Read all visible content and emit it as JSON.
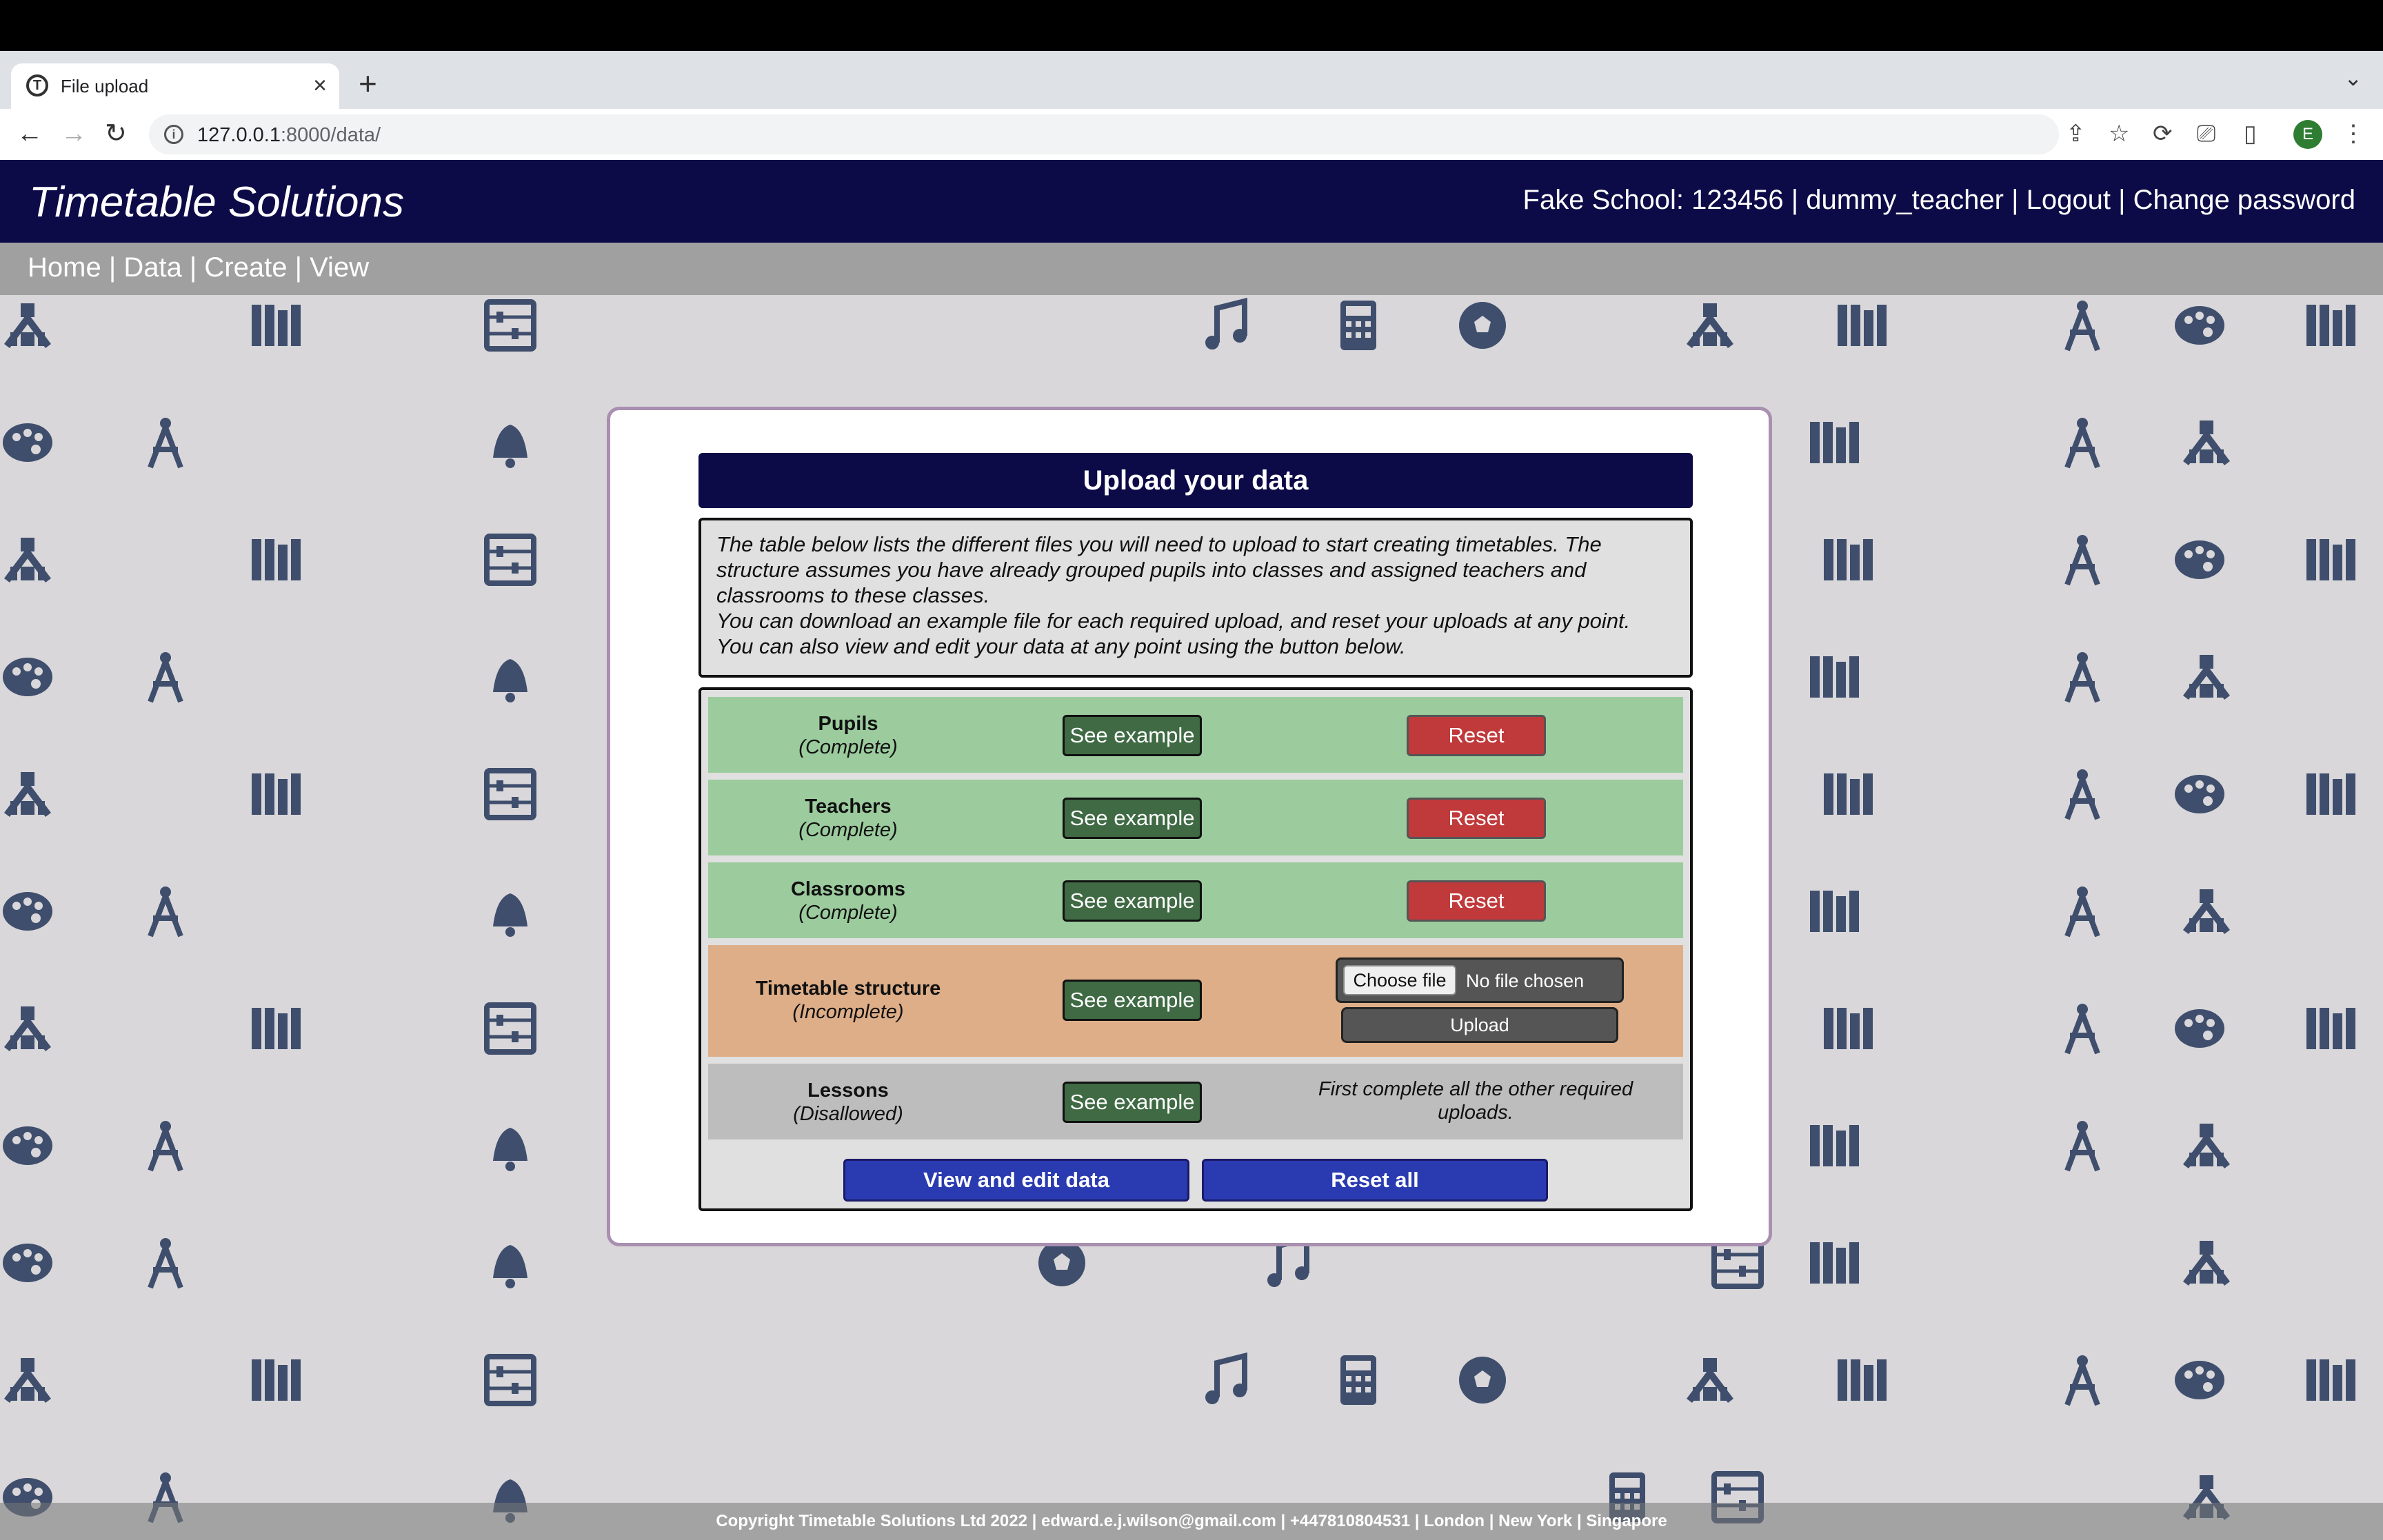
{
  "browser": {
    "tab_title": "File upload",
    "tab_close": "×",
    "new_tab": "+",
    "url_host": "127.0.0.1",
    "url_path": ":8000/data/",
    "profile_initial": "E"
  },
  "header": {
    "brand": "Timetable Solutions",
    "account": "Fake School: 123456 | dummy_teacher | Logout | Change password"
  },
  "nav": {
    "links": "Home | Data | Create | View"
  },
  "modal": {
    "title": "Upload your data",
    "intro": [
      "The table below lists the different files you will need to upload to start creating timetables. The structure assumes you have already grouped pupils into classes and assigned teachers and classrooms to these classes.",
      "You can download an example file for each required upload, and reset your uploads at any point.",
      "You can also view and edit your data at any point using the button below."
    ],
    "rows": [
      {
        "name": "Pupils",
        "status": "(Complete)",
        "example_label": "See example",
        "reset_label": "Reset"
      },
      {
        "name": "Teachers",
        "status": "(Complete)",
        "example_label": "See example",
        "reset_label": "Reset"
      },
      {
        "name": "Classrooms",
        "status": "(Complete)",
        "example_label": "See example",
        "reset_label": "Reset"
      },
      {
        "name": "Timetable structure",
        "status": "(Incomplete)",
        "example_label": "See example",
        "choose_file": "Choose file",
        "no_file": "No file chosen",
        "upload_label": "Upload"
      },
      {
        "name": "Lessons",
        "status": "(Disallowed)",
        "example_label": "See example",
        "note": "First complete all the other required uploads."
      }
    ],
    "view_edit_label": "View and edit data",
    "reset_all_label": "Reset all"
  },
  "footer": {
    "text": "Copyright Timetable Solutions Ltd 2022 | edward.e.j.wilson@gmail.com | +447810804531 | London | New York | Singapore"
  },
  "colors": {
    "navy": "#0c0a47",
    "complete": "#9ccc9e",
    "incomplete": "#deae88",
    "disallowed": "#bdbdbd",
    "reset_red": "#c0393b",
    "example_green": "#3f6a44",
    "action_blue": "#2a3ab0"
  }
}
